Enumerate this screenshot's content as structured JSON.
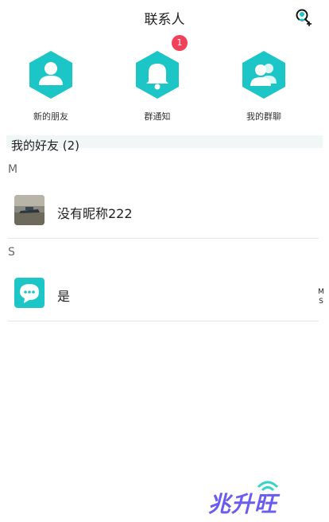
{
  "header": {
    "title": "联系人",
    "add_icon": "add-contact-icon"
  },
  "shortcuts": [
    {
      "label": "新的朋友",
      "icon": "user-icon"
    },
    {
      "label": "群通知",
      "icon": "bell-icon",
      "badge": "1"
    },
    {
      "label": "我的群聊",
      "icon": "group-icon"
    }
  ],
  "friends": {
    "title": "我的好友 (2)",
    "groups": [
      {
        "letter": "M",
        "items": [
          {
            "name": "没有昵称222",
            "avatar": "photo-avatar"
          }
        ]
      },
      {
        "letter": "S",
        "items": [
          {
            "name": "是",
            "avatar": "chat-bubble-avatar"
          }
        ]
      }
    ]
  },
  "index_bar": [
    "M",
    "S"
  ],
  "watermark": "兆升旺",
  "colors": {
    "accent": "#1cc6c6",
    "badge": "#f0405a",
    "divider": "#e4e4e4"
  }
}
